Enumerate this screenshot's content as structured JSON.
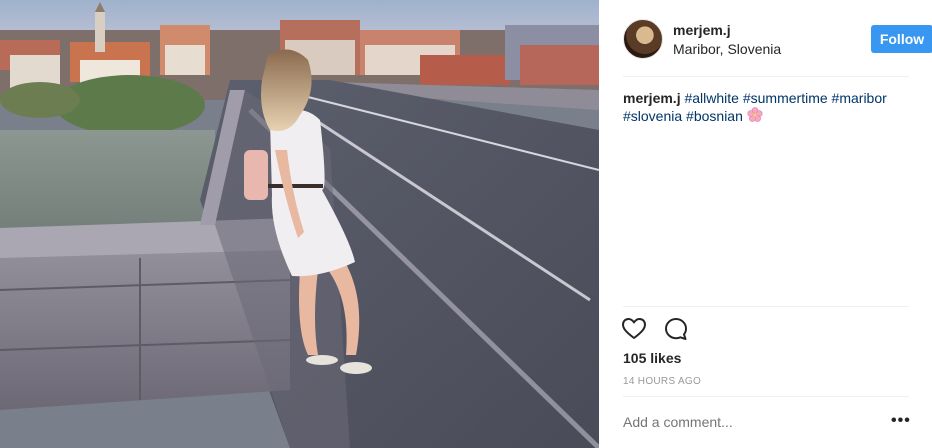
{
  "post": {
    "username": "merjem.j",
    "location": "Maribor, Slovenia",
    "follow_label": "Follow",
    "caption": {
      "user": "merjem.j",
      "tags": [
        "#allwhite",
        "#summertime",
        "#maribor",
        "#slovenia",
        "#bosnian"
      ],
      "emoji": "cherry-blossom-icon"
    },
    "likes_text": "105 likes",
    "timestamp": "14 HOURS AGO",
    "comment_placeholder": "Add a comment...",
    "more_label": "•••"
  },
  "icons": {
    "like": "heart-outline-icon",
    "comment": "speech-bubble-icon",
    "more": "ellipsis-icon"
  },
  "colors": {
    "follow_button": "#3897f0",
    "hashtag": "#003569",
    "muted": "#999999",
    "text": "#262626"
  },
  "photo": {
    "description_alt": ""
  }
}
